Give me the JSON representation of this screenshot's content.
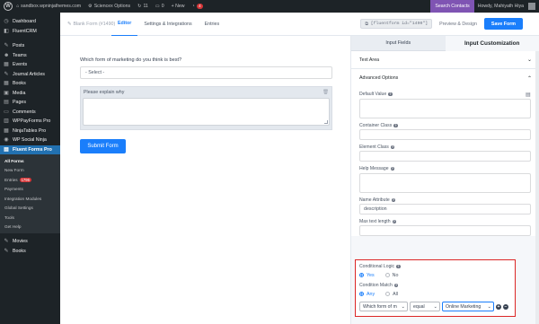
{
  "adminbar": {
    "site": "sandbox.wpninjathemes.com",
    "plugin": "Sciencex Options",
    "comments_count": "11",
    "comment_icon_count": "0",
    "new_label": "+ New",
    "updates_badge": "4",
    "search_contacts": "Search Contacts",
    "howdy": "Howdy, Mahiyath Hiya"
  },
  "sidebar": {
    "items_top": [
      {
        "label": "Dashboard",
        "icon": "dashboard-icon",
        "glyph": "◷"
      },
      {
        "label": "FluentCRM",
        "icon": "fluentcrm-icon",
        "glyph": "◧"
      }
    ],
    "items_mid": [
      {
        "label": "Posts",
        "icon": "pin-icon",
        "glyph": "✎"
      },
      {
        "label": "Teams",
        "icon": "teams-icon",
        "glyph": "☻"
      },
      {
        "label": "Events",
        "icon": "events-icon",
        "glyph": "▦"
      },
      {
        "label": "Journal Articles",
        "icon": "pin-icon",
        "glyph": "✎"
      },
      {
        "label": "Books",
        "icon": "books-icon",
        "glyph": "▦"
      },
      {
        "label": "Media",
        "icon": "media-icon",
        "glyph": "▣"
      },
      {
        "label": "Pages",
        "icon": "pages-icon",
        "glyph": "▤"
      },
      {
        "label": "Comments",
        "icon": "comments-icon",
        "glyph": "▭"
      },
      {
        "label": "WPPayForms Pro",
        "icon": "payforms-icon",
        "glyph": "▥"
      },
      {
        "label": "NinjaTables Pro",
        "icon": "tables-icon",
        "glyph": "▦"
      },
      {
        "label": "WP Social Ninja",
        "icon": "social-icon",
        "glyph": "◉"
      }
    ],
    "active_item": {
      "label": "Fluent Forms Pro",
      "icon": "fluent-forms-icon",
      "glyph": "▤"
    },
    "submenu": [
      {
        "label": "All Forms",
        "current": true
      },
      {
        "label": "New Form"
      },
      {
        "label": "Entries",
        "count": "1796"
      },
      {
        "label": "Payments"
      },
      {
        "label": "Integration Modules"
      },
      {
        "label": "Global Settings"
      },
      {
        "label": "Tools"
      },
      {
        "label": "Get Help"
      }
    ],
    "items_bottom": [
      {
        "label": "Movies",
        "icon": "pin-icon",
        "glyph": "✎"
      },
      {
        "label": "Books",
        "icon": "pin-icon",
        "glyph": "✎"
      }
    ]
  },
  "header": {
    "breadcrumb": "Blank Form (#1490)",
    "tabs": [
      "Editor",
      "Settings & Integrations",
      "Entries"
    ],
    "shortcode": "[fluentform id=\"1490\"]",
    "preview": "Preview & Design",
    "save": "Save Form"
  },
  "form": {
    "question_label": "Which form of marketing do you think is best?",
    "select_placeholder": "- Select -",
    "textarea_label": "Please explain why",
    "submit_label": "Submit Form"
  },
  "panel": {
    "tabs": [
      "Input Fields",
      "Input Customization"
    ],
    "section_collapsed": "Text Area",
    "section_open": "Advanced Options",
    "fields": {
      "default_value": "Default Value",
      "container_class": "Container Class",
      "element_class": "Element Class",
      "help_message": "Help Message",
      "name_attribute": "Name Attribute",
      "name_value": "description",
      "max_length": "Max text length"
    },
    "conditional": {
      "label": "Conditional Logic",
      "yes": "Yes",
      "no": "No",
      "match_label": "Condition Match",
      "any": "Any",
      "all": "All",
      "rule_field": "Which form of m",
      "rule_operator": "equal",
      "rule_value": "Online Marketing"
    }
  },
  "colors": {
    "accent": "#1a7efb",
    "admin_dark": "#1d2327",
    "highlight_border": "#dc2626",
    "wp_blue": "#2271b1"
  }
}
